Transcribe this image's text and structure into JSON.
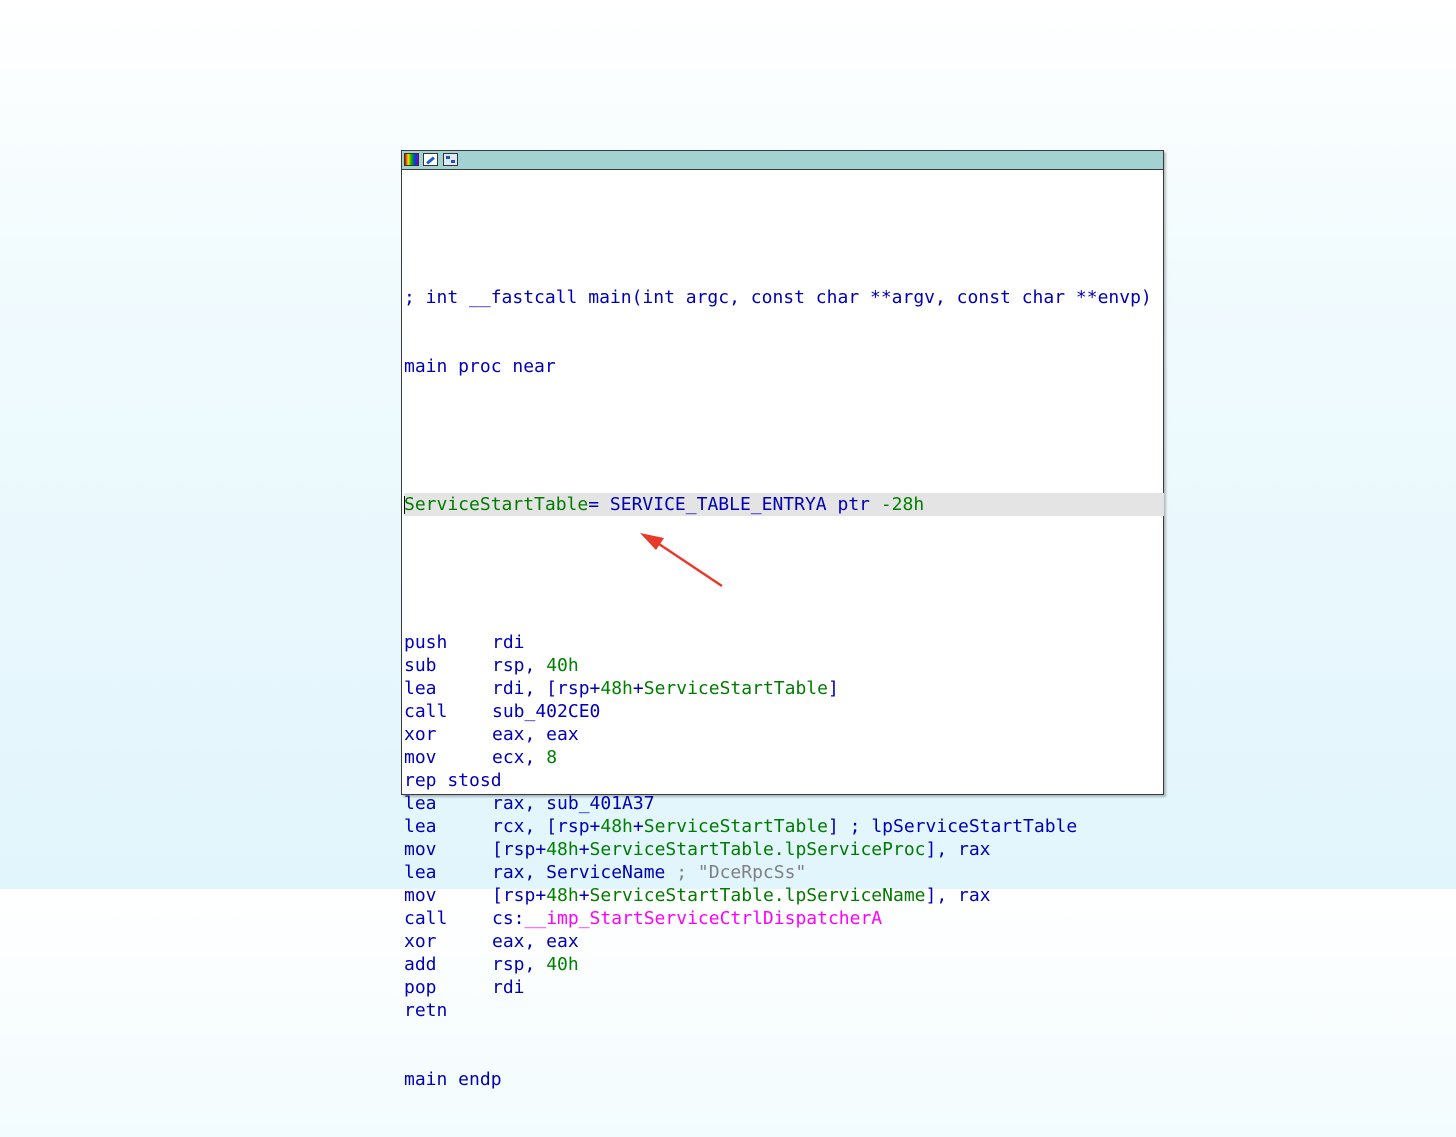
{
  "window": {
    "toolbar_icons": [
      "palette-icon",
      "edit-node-icon",
      "graph-overview-icon"
    ]
  },
  "code": {
    "signature": "; int __fastcall main(int argc, const char **argv, const char **envp)",
    "proc_start": "main proc near",
    "var_name": "ServiceStartTable",
    "var_eq": "= SERVICE_TABLE_ENTRYA ptr ",
    "var_offset": "-28h",
    "instructions": [
      {
        "mnemonic": "push",
        "parts": [
          {
            "t": "rdi",
            "c": "op"
          }
        ]
      },
      {
        "mnemonic": "sub",
        "parts": [
          {
            "t": "rsp, ",
            "c": "op"
          },
          {
            "t": "40h",
            "c": "num"
          }
        ]
      },
      {
        "mnemonic": "lea",
        "parts": [
          {
            "t": "rdi, [rsp+",
            "c": "op"
          },
          {
            "t": "48h",
            "c": "num"
          },
          {
            "t": "+",
            "c": "op"
          },
          {
            "t": "ServiceStartTable",
            "c": "var"
          },
          {
            "t": "]",
            "c": "op"
          }
        ]
      },
      {
        "mnemonic": "call",
        "parts": [
          {
            "t": "sub_402CE0",
            "c": "op"
          }
        ]
      },
      {
        "mnemonic": "xor",
        "parts": [
          {
            "t": "eax, eax",
            "c": "op"
          }
        ]
      },
      {
        "mnemonic": "mov",
        "parts": [
          {
            "t": "ecx, ",
            "c": "op"
          },
          {
            "t": "8",
            "c": "num"
          }
        ]
      },
      {
        "mnemonic": "rep stosd",
        "parts": []
      },
      {
        "mnemonic": "lea",
        "parts": [
          {
            "t": "rax, sub_401A37",
            "c": "op"
          }
        ]
      },
      {
        "mnemonic": "lea",
        "parts": [
          {
            "t": "rcx, [rsp+",
            "c": "op"
          },
          {
            "t": "48h",
            "c": "num"
          },
          {
            "t": "+",
            "c": "op"
          },
          {
            "t": "ServiceStartTable",
            "c": "var"
          },
          {
            "t": "] ; lpServiceStartTable",
            "c": "op"
          }
        ]
      },
      {
        "mnemonic": "mov",
        "parts": [
          {
            "t": "[rsp+",
            "c": "op"
          },
          {
            "t": "48h",
            "c": "num"
          },
          {
            "t": "+",
            "c": "op"
          },
          {
            "t": "ServiceStartTable.lpServiceProc",
            "c": "var"
          },
          {
            "t": "], rax",
            "c": "op"
          }
        ]
      },
      {
        "mnemonic": "lea",
        "parts": [
          {
            "t": "rax, ServiceName ",
            "c": "op"
          },
          {
            "t": "; \"DceRpcSs\"",
            "c": "cmt"
          }
        ]
      },
      {
        "mnemonic": "mov",
        "parts": [
          {
            "t": "[rsp+",
            "c": "op"
          },
          {
            "t": "48h",
            "c": "num"
          },
          {
            "t": "+",
            "c": "op"
          },
          {
            "t": "ServiceStartTable.lpServiceName",
            "c": "var"
          },
          {
            "t": "], rax",
            "c": "op"
          }
        ]
      },
      {
        "mnemonic": "call",
        "parts": [
          {
            "t": "cs:",
            "c": "op"
          },
          {
            "t": "__imp_StartServiceCtrlDispatcherA",
            "c": "imp"
          }
        ]
      },
      {
        "mnemonic": "xor",
        "parts": [
          {
            "t": "eax, eax",
            "c": "op"
          }
        ]
      },
      {
        "mnemonic": "add",
        "parts": [
          {
            "t": "rsp, ",
            "c": "op"
          },
          {
            "t": "40h",
            "c": "num"
          }
        ]
      },
      {
        "mnemonic": "pop",
        "parts": [
          {
            "t": "rdi",
            "c": "op"
          }
        ]
      },
      {
        "mnemonic": "retn",
        "parts": []
      }
    ],
    "proc_end": "main endp"
  },
  "colors": {
    "titlebar": "#a2d2d1",
    "code_default": "#0000b4",
    "number": "#008000",
    "variable": "#007a00",
    "import": "#ff00ff",
    "comment": "#808080",
    "highlight_line": "#e4e4e4",
    "annotation_arrow": "#e8392b"
  }
}
